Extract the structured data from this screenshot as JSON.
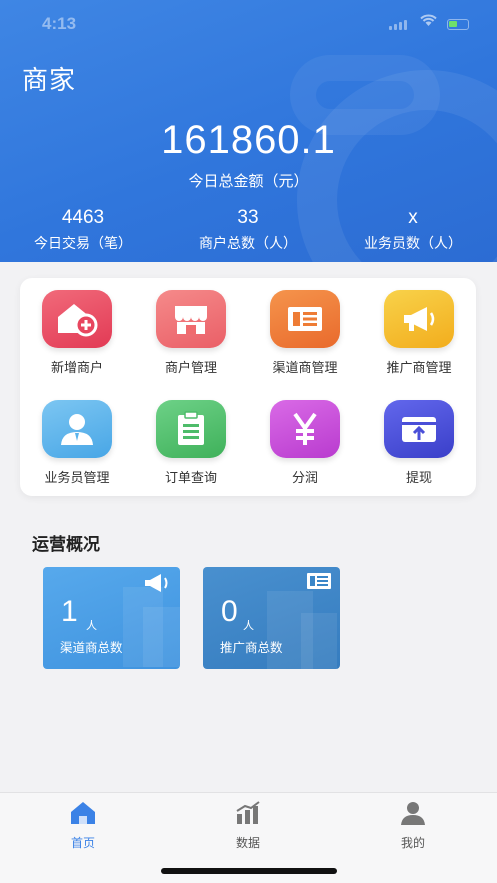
{
  "status_bar": {
    "time": "4:13"
  },
  "header": {
    "title": "商家",
    "total_amount": "161860.1",
    "total_label": "今日总金额（元）",
    "stats": [
      {
        "value": "4463",
        "label": "今日交易（笔）"
      },
      {
        "value": "33",
        "label": "商户总数（人）"
      },
      {
        "value": "x",
        "label": "业务员数（人）"
      }
    ]
  },
  "grid": [
    {
      "label": "新增商户",
      "icon": "add-store-icon",
      "color": "#e8465f"
    },
    {
      "label": "商户管理",
      "icon": "store-icon",
      "color": "#ef6b6e"
    },
    {
      "label": "渠道商管理",
      "icon": "list-icon",
      "color": "#ee7c35"
    },
    {
      "label": "推广商管理",
      "icon": "megaphone-icon",
      "color": "#f5be2a"
    },
    {
      "label": "业务员管理",
      "icon": "person-icon",
      "color": "#5bb4ec"
    },
    {
      "label": "订单查询",
      "icon": "clipboard-icon",
      "color": "#4ebc6a"
    },
    {
      "label": "分润",
      "icon": "yen-icon",
      "color": "#c649d8"
    },
    {
      "label": "提现",
      "icon": "withdraw-icon",
      "color": "#4a4fd8"
    }
  ],
  "operations": {
    "title": "运营概况",
    "cards": [
      {
        "value": "1",
        "unit": "人",
        "label": "渠道商总数",
        "icon": "megaphone-icon",
        "color": "#4a9fe6"
      },
      {
        "value": "0",
        "unit": "人",
        "label": "推广商总数",
        "icon": "list-icon",
        "color": "#3a86c8"
      }
    ]
  },
  "tabbar": [
    {
      "label": "首页",
      "icon": "home-icon",
      "active": true
    },
    {
      "label": "数据",
      "icon": "bar-chart-icon",
      "active": false
    },
    {
      "label": "我的",
      "icon": "user-icon",
      "active": false
    }
  ]
}
